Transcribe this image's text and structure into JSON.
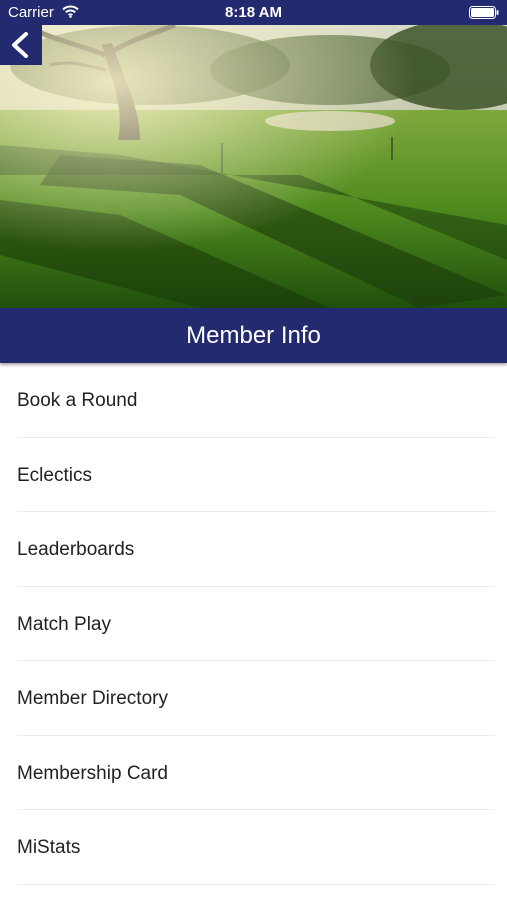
{
  "status_bar": {
    "carrier": "Carrier",
    "time": "8:18 AM",
    "wifi_icon": "wifi-icon",
    "battery_icon": "battery-icon"
  },
  "hero": {
    "image": "golf-course-photo"
  },
  "back_button": {
    "icon": "chevron-left-icon"
  },
  "header": {
    "title": "Member Info"
  },
  "menu": {
    "items": [
      {
        "label": "Book a Round"
      },
      {
        "label": "Eclectics"
      },
      {
        "label": "Leaderboards"
      },
      {
        "label": "Match Play"
      },
      {
        "label": "Member Directory"
      },
      {
        "label": "Membership Card"
      },
      {
        "label": "MiStats"
      }
    ]
  },
  "colors": {
    "brand": "#232a6f",
    "background": "#ffffff",
    "text": "#222222",
    "divider": "#ececec"
  }
}
